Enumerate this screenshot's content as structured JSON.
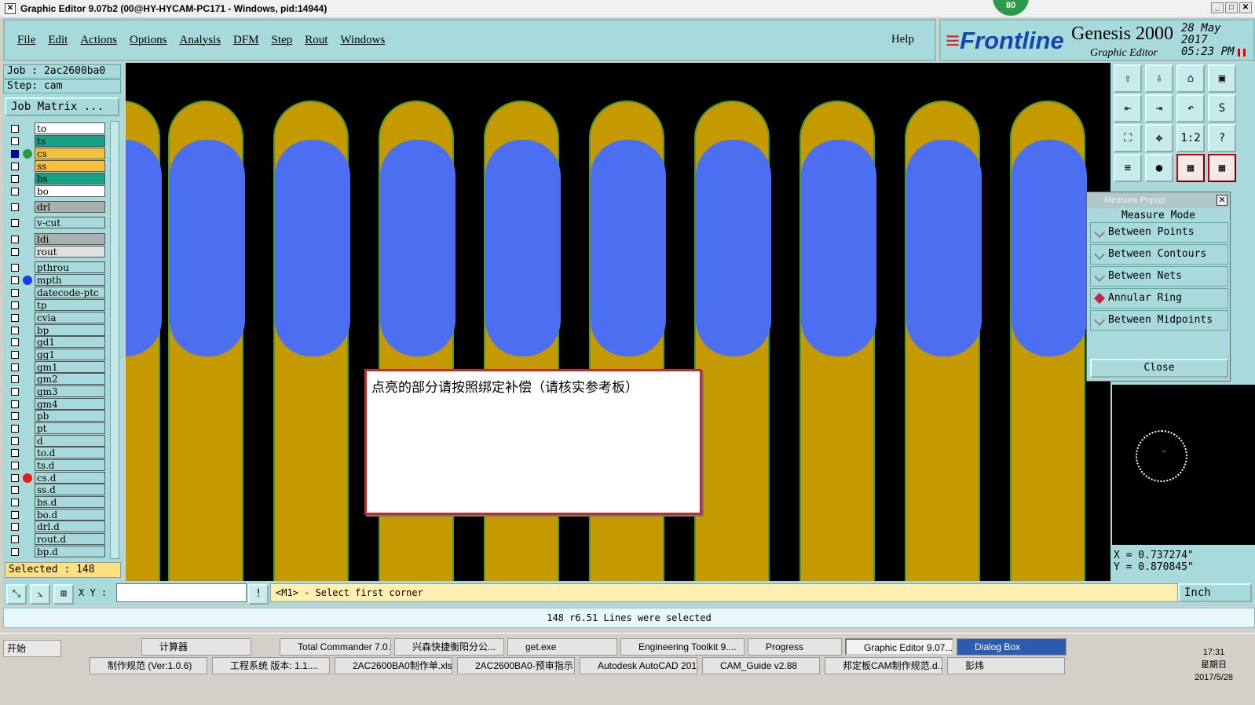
{
  "window": {
    "title": "Graphic Editor 9.07b2 (00@HY-HYCAM-PC171 - Windows, pid:14944)",
    "badge": "80"
  },
  "menu": [
    "File",
    "Edit",
    "Actions",
    "Options",
    "Analysis",
    "DFM",
    "Step",
    "Rout",
    "Windows"
  ],
  "help_label": "Help",
  "brand": {
    "logo": "Frontline",
    "product": "Genesis 2000",
    "subtitle": "Graphic Editor",
    "date": "28 May 2017",
    "time": "05:23 PM"
  },
  "job": {
    "job_line": "Job : 2ac2600ba0",
    "step_line": "Step: cam",
    "matrix_button": "Job Matrix ..."
  },
  "layers": [
    {
      "name": "to",
      "color": "#ffffff",
      "checked": false,
      "dot": ""
    },
    {
      "name": "ts",
      "color": "#16a085",
      "checked": false,
      "dot": ""
    },
    {
      "name": "cs",
      "color": "#f5c040",
      "checked": true,
      "dot": "edit"
    },
    {
      "name": "ss",
      "color": "#f5c040",
      "checked": false,
      "dot": ""
    },
    {
      "name": "bs",
      "color": "#16a085",
      "checked": false,
      "dot": ""
    },
    {
      "name": "bo",
      "color": "#ffffff",
      "checked": false,
      "dot": ""
    },
    {
      "name": "drl",
      "color": "#a8b0b0",
      "checked": false,
      "dot": ""
    },
    {
      "name": "v-cut",
      "color": "#a8dadc",
      "checked": false,
      "dot": ""
    },
    {
      "name": "ldi",
      "color": "#a8b0b0",
      "checked": false,
      "dot": ""
    },
    {
      "name": "rout",
      "color": "#e0e0e0",
      "checked": false,
      "dot": ""
    },
    {
      "name": "pthrou",
      "color": "#a8dadc",
      "checked": false,
      "dot": ""
    },
    {
      "name": "mpth",
      "color": "#a8dadc",
      "checked": false,
      "dot": "#1a3be8"
    },
    {
      "name": "datecode-ptc",
      "color": "#a8dadc",
      "checked": false,
      "dot": ""
    },
    {
      "name": "tp",
      "color": "#a8dadc",
      "checked": false,
      "dot": ""
    },
    {
      "name": "cvia",
      "color": "#a8dadc",
      "checked": false,
      "dot": ""
    },
    {
      "name": "bp",
      "color": "#a8dadc",
      "checked": false,
      "dot": ""
    },
    {
      "name": "gd1",
      "color": "#a8dadc",
      "checked": false,
      "dot": ""
    },
    {
      "name": "gg1",
      "color": "#a8dadc",
      "checked": false,
      "dot": ""
    },
    {
      "name": "gm1",
      "color": "#a8dadc",
      "checked": false,
      "dot": ""
    },
    {
      "name": "gm2",
      "color": "#a8dadc",
      "checked": false,
      "dot": ""
    },
    {
      "name": "gm3",
      "color": "#a8dadc",
      "checked": false,
      "dot": ""
    },
    {
      "name": "gm4",
      "color": "#a8dadc",
      "checked": false,
      "dot": ""
    },
    {
      "name": "pb",
      "color": "#a8dadc",
      "checked": false,
      "dot": ""
    },
    {
      "name": "pt",
      "color": "#a8dadc",
      "checked": false,
      "dot": ""
    },
    {
      "name": "d",
      "color": "#a8dadc",
      "checked": false,
      "dot": ""
    },
    {
      "name": "to.d",
      "color": "#a8dadc",
      "checked": false,
      "dot": ""
    },
    {
      "name": "ts.d",
      "color": "#a8dadc",
      "checked": false,
      "dot": ""
    },
    {
      "name": "cs.d",
      "color": "#a8dadc",
      "checked": false,
      "dot": "#e81a1a"
    },
    {
      "name": "ss.d",
      "color": "#a8dadc",
      "checked": false,
      "dot": ""
    },
    {
      "name": "bs.d",
      "color": "#a8dadc",
      "checked": false,
      "dot": ""
    },
    {
      "name": "bo.d",
      "color": "#a8dadc",
      "checked": false,
      "dot": ""
    },
    {
      "name": "drl.d",
      "color": "#a8dadc",
      "checked": false,
      "dot": ""
    },
    {
      "name": "rout.d",
      "color": "#a8dadc",
      "checked": false,
      "dot": ""
    },
    {
      "name": "bp.d",
      "color": "#a8dadc",
      "checked": false,
      "dot": ""
    }
  ],
  "selected": "Selected : 148",
  "message_box": "点亮的部分请按照绑定补偿（请核实参考板）",
  "toolbar_icons": [
    "layer-up-icon",
    "layer-down-icon",
    "home-icon",
    "window-icon",
    "prev-icon",
    "next-icon",
    "zoom-back-icon",
    "rout-icon",
    "fit-all-icon",
    "pan-icon",
    "scale-1-2-icon",
    "step-icon",
    "measure-tool-icon",
    "probe-icon",
    "nets-icon",
    "netlist-icon"
  ],
  "tool_glyphs": [
    "⇧",
    "⇩",
    "⌂",
    "▣",
    "⇤",
    "⇥",
    "↶",
    "S",
    "⛶",
    "✥",
    "1:2",
    "?",
    "≡",
    "●",
    "▦",
    "▦"
  ],
  "measure": {
    "title": "Measure Popup",
    "mode_label": "Measure Mode",
    "options": [
      "Between Points",
      "Between Contours",
      "Between Nets",
      "Annular Ring",
      "Between Midpoints"
    ],
    "selected_option": "Annular Ring",
    "close_label": "Close"
  },
  "coords": {
    "x": "X = 0.737274\"",
    "y": "Y = 0.870845\""
  },
  "cmd": {
    "xy_label": "X Y :",
    "xy_value": "",
    "prompt": "<M1> - Select first corner",
    "units": "Inch"
  },
  "status": "148 r6.51 Lines were selected",
  "taskbar": {
    "start": "开始",
    "row1": [
      "计算器",
      "Total Commander 7.0...",
      "兴森快捷衡阳分公...",
      "get.exe",
      "Engineering Toolkit 9....",
      "Progress",
      "Graphic Editor 9.07...",
      "Dialog Box"
    ],
    "row2": [
      "制作规范 (Ver:1.0.6)",
      "工程系统  版本: 1.1....",
      "2AC2600BA0制作单.xls...",
      "2AC2600BA0-预审指示...",
      "Autodesk AutoCAD 201...",
      "CAM_Guide v2.88",
      "邦定板CAM制作规范.d...",
      "彭炜"
    ],
    "clock_time": "17:31",
    "clock_day": "星期日",
    "clock_date": "2017/5/28"
  },
  "colors": {
    "copper": "#c49a00",
    "pad": "#4b6ff0",
    "panel": "#a8dadc",
    "message_border": "#c42a2a"
  }
}
